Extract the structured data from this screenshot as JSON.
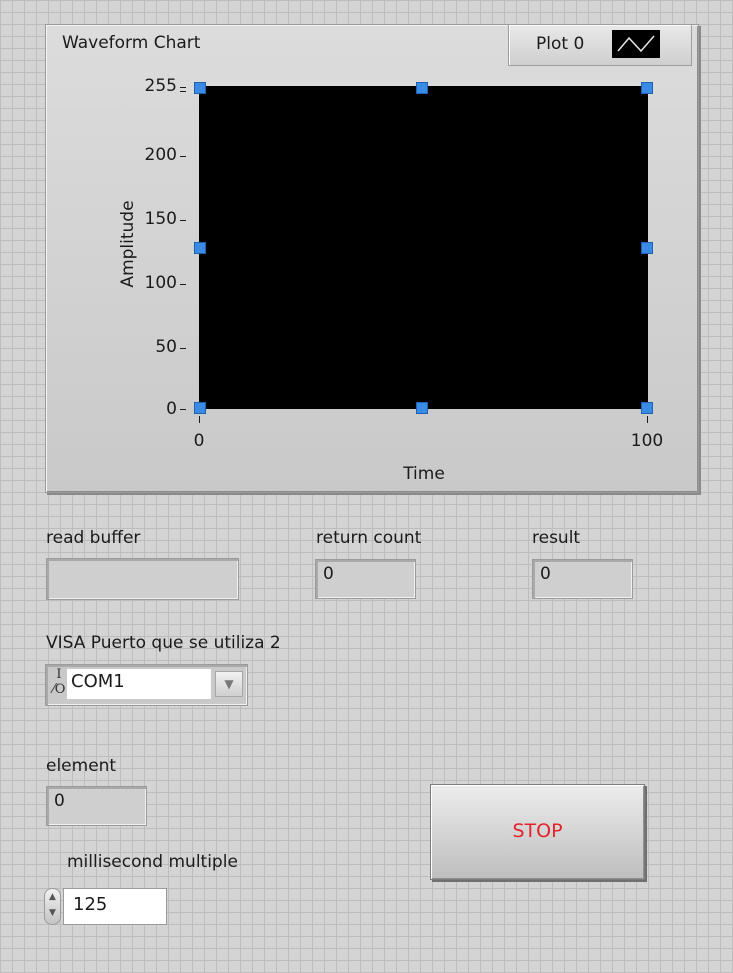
{
  "chart": {
    "title": "Waveform Chart",
    "legend_label": "Plot 0",
    "ylabel": "Amplitude",
    "xlabel": "Time",
    "ytick_255": "255",
    "ytick_200": "200",
    "ytick_150": "150",
    "ytick_100": "100",
    "ytick_50": "50",
    "ytick_0": "0",
    "xtick_0": "0",
    "xtick_100": "100"
  },
  "chart_data": {
    "type": "line",
    "title": "Waveform Chart",
    "xlabel": "Time",
    "ylabel": "Amplitude",
    "xlim": [
      0,
      100
    ],
    "ylim": [
      0,
      255
    ],
    "x_ticks": [
      0,
      100
    ],
    "y_ticks": [
      0,
      50,
      100,
      150,
      200,
      255
    ],
    "legend": "top-right",
    "series": [
      {
        "name": "Plot 0",
        "values": []
      }
    ],
    "plot_background": "#000000"
  },
  "read_buffer": {
    "label": "read buffer",
    "value": ""
  },
  "return_count": {
    "label": "return count",
    "value": "0"
  },
  "result": {
    "label": "result",
    "value": "0"
  },
  "visa": {
    "label": "VISA Puerto que se utiliza 2",
    "value": "COM1",
    "icon_text": "I/O"
  },
  "element": {
    "label": "element",
    "value": "0"
  },
  "stop": {
    "label": "STOP",
    "color": "#e3232b"
  },
  "ms_multiple": {
    "label": "millisecond multiple",
    "value": "125"
  },
  "colors": {
    "handle": "#3a8be6",
    "panel": "#d4d4d4"
  }
}
